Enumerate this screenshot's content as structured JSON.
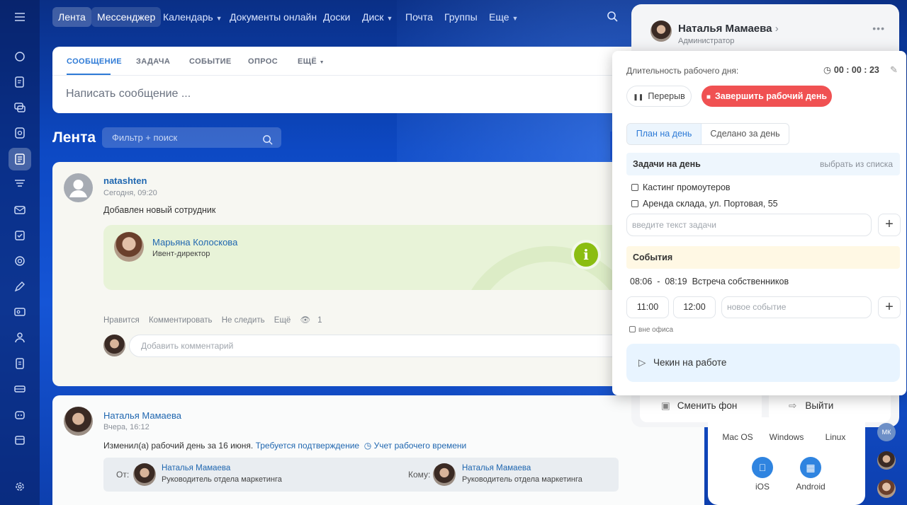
{
  "nav": {
    "items": [
      "Лента",
      "Мессенджер",
      "Календарь",
      "Документы онлайн",
      "Доски",
      "Диск",
      "Почта",
      "Группы",
      "Еще"
    ]
  },
  "composer": {
    "tabs": [
      "СООБЩЕНИЕ",
      "ЗАДАЧА",
      "СОБЫТИЕ",
      "ОПРОС",
      "ЕЩЁ"
    ],
    "placeholder": "Написать сообщение ..."
  },
  "feed": {
    "title": "Лента",
    "filter_placeholder": "Фильтр + поиск"
  },
  "post1": {
    "author": "natashten",
    "time": "Сегодня, 09:20",
    "text": "Добавлен новый сотрудник",
    "employee_name": "Марьяна Колоскова",
    "employee_role": "Ивент-директор",
    "actions": [
      "Нравится",
      "Комментировать",
      "Не следить",
      "Ещё"
    ],
    "views": "1",
    "comment_placeholder": "Добавить комментарий"
  },
  "post2": {
    "author": "Наталья Мамаева",
    "time": "Вчера, 16:12",
    "text": "Изменил(а) рабочий день за 16 июня.",
    "link1": "Требуется подтверждение",
    "link2": "Учет рабочего времени",
    "from_label": "От:",
    "to_label": "Кому:",
    "from_name": "Наталья Мамаева",
    "from_role": "Руководитель отдела маркетинга",
    "to_name": "Наталья Мамаева",
    "to_role": "Руководитель отдела маркетинга"
  },
  "profile": {
    "name": "Наталья Мамаева",
    "role": "Администратор",
    "change_bg": "Сменить фон",
    "logout": "Выйти",
    "apps": [
      "Mac OS",
      "Windows",
      "Linux",
      "iOS",
      "Android"
    ],
    "mini_avatar": "МК"
  },
  "workday": {
    "duration_label": "Длительность рабочего дня:",
    "timer": "00 : 00 : 23",
    "pause": "Перерыв",
    "end": "Завершить рабочий день",
    "tab_plan": "План на день",
    "tab_done": "Сделано за день",
    "tasks_title": "Задачи на день",
    "tasks_pick": "выбрать из списка",
    "tasks": [
      "Кастинг промоутеров",
      "Аренда склада, ул. Портовая, 55"
    ],
    "task_placeholder": "введите текст задачи",
    "events_title": "События",
    "event_time": "08:06  -  08:19",
    "event_name": "Встреча собственников",
    "time_from": "11:00",
    "time_to": "12:00",
    "event_placeholder": "новое событие",
    "out_of_office": "вне офиса",
    "checkin": "Чекин на работе"
  }
}
